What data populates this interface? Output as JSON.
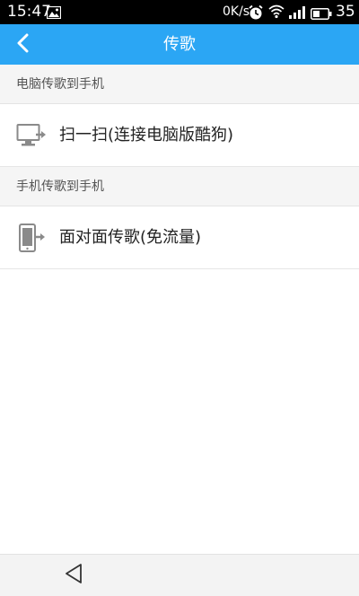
{
  "status_bar": {
    "time": "15:47",
    "network_speed": "0K/s",
    "battery_level": "35",
    "icons": [
      "image-icon",
      "alarm-icon",
      "wifi-icon",
      "signal-icon",
      "battery-icon"
    ]
  },
  "header": {
    "title": "传歌",
    "back_icon": "chevron-left-icon",
    "background_color": "#2ba6f4"
  },
  "sections": [
    {
      "header": "电脑传歌到手机",
      "item": {
        "label": "扫一扫(连接电脑版酷狗)",
        "icon": "computer-transfer-icon"
      }
    },
    {
      "header": "手机传歌到手机",
      "item": {
        "label": "面对面传歌(免流量)",
        "icon": "phone-transfer-icon"
      }
    }
  ],
  "nav_bar": {
    "back_icon": "triangle-back-icon"
  }
}
